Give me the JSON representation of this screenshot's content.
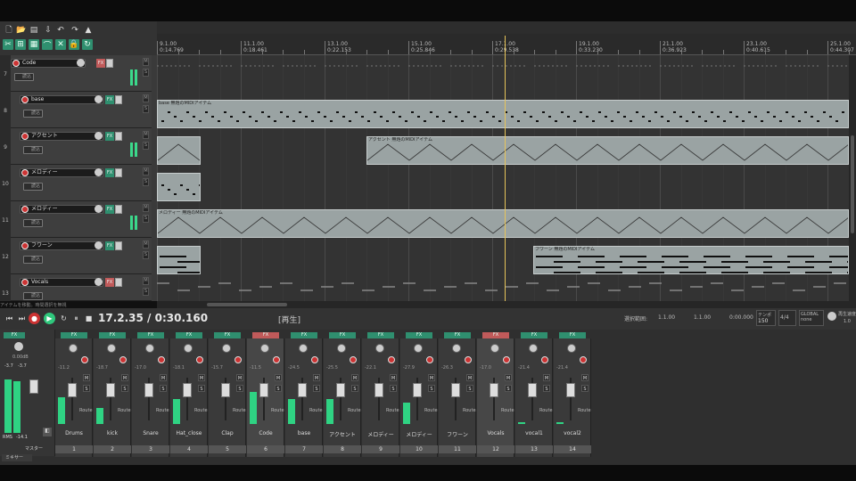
{
  "ruler": {
    "markers": [
      {
        "bar": "9.1.00",
        "time": "0:14.769"
      },
      {
        "bar": "11.1.00",
        "time": "0:18.461"
      },
      {
        "bar": "13.1.00",
        "time": "0:22.153"
      },
      {
        "bar": "15.1.00",
        "time": "0:25.846"
      },
      {
        "bar": "17.1.00",
        "time": "0:29.538"
      },
      {
        "bar": "19.1.00",
        "time": "0:33.230"
      },
      {
        "bar": "21.1.00",
        "time": "0:36.923"
      },
      {
        "bar": "23.1.00",
        "time": "0:40.615"
      },
      {
        "bar": "25.1.00",
        "time": "0:44.307"
      }
    ]
  },
  "tracks": [
    {
      "num": "7",
      "name": "Code",
      "auto": "読込"
    },
    {
      "num": "8",
      "name": "base",
      "auto": "読込"
    },
    {
      "num": "9",
      "name": "アクセント",
      "auto": "読込"
    },
    {
      "num": "10",
      "name": "メロディー",
      "auto": "読込"
    },
    {
      "num": "11",
      "name": "メロディー",
      "auto": "読込"
    },
    {
      "num": "12",
      "name": "フワーン",
      "auto": "読込"
    },
    {
      "num": "13",
      "name": "Vocals",
      "auto": "読込"
    }
  ],
  "items": {
    "base": "base 無題のMIDIアイテム",
    "accent": "アクセント 無題のMIDIアイテム",
    "melody": "メロディー 無題のMIDIアイテム",
    "fuwan": "フワーン 無題のMIDIアイテム"
  },
  "status_message": "アイテムを移動。時間選択を無視",
  "transport": {
    "position": "17.2.35 / 0:30.160",
    "state": "[再生]",
    "selection_label": "選択範囲:",
    "sel_start": "1.1.00",
    "sel_end": "1.1.00",
    "sel_len": "0:00.000",
    "bpm_label": "テンポ",
    "bpm": "150",
    "timesig": "4/4",
    "global_label": "GLOBAL",
    "global_value": "none",
    "rate_label": "再生速度",
    "rate": "1.0"
  },
  "master": {
    "volume": "0.00dB",
    "peak_l": "-3.7",
    "peak_r": "-3.7",
    "rms_label": "RMS",
    "rms_value": "-14.1",
    "label": "マスター"
  },
  "mixer_strips": [
    {
      "name": "Drums",
      "num": "1",
      "db": "-11.2"
    },
    {
      "name": "kick",
      "num": "2",
      "db": "-18.7"
    },
    {
      "name": "Snare",
      "num": "3",
      "db": "-17.0"
    },
    {
      "name": "Hat_close",
      "num": "4",
      "db": "-18.1"
    },
    {
      "name": "Clap",
      "num": "5",
      "db": "-15.7"
    },
    {
      "name": "Code",
      "num": "6",
      "db": "-11.5"
    },
    {
      "name": "base",
      "num": "7",
      "db": "-24.5"
    },
    {
      "name": "アクセント",
      "num": "8",
      "db": "-25.5"
    },
    {
      "name": "メロディー",
      "num": "9",
      "db": "-22.1"
    },
    {
      "name": "メロディー",
      "num": "10",
      "db": "-27.9"
    },
    {
      "name": "フワーン",
      "num": "11",
      "db": "-26.3"
    },
    {
      "name": "Vocals",
      "num": "12",
      "db": "-17.0"
    },
    {
      "name": "vocal1",
      "num": "13",
      "db": "-21.4"
    },
    {
      "name": "vocal2",
      "num": "14",
      "db": "-21.4"
    }
  ],
  "mixer_tab": "ミキサー",
  "labels": {
    "fx": "FX",
    "route": "Route",
    "m": "M",
    "s": "S"
  },
  "colors": {
    "accent": "#2f8f6f",
    "cursor": "#e7c45a",
    "meter": "#3bd98b",
    "item": "#9aa3a3"
  }
}
